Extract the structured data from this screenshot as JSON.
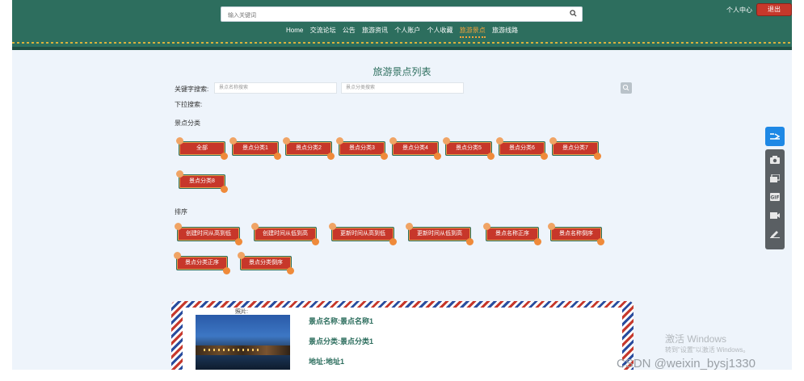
{
  "header": {
    "search_placeholder": "输入关键词",
    "nav": [
      "Home",
      "交流论坛",
      "公告",
      "旅游资讯",
      "个人账户",
      "个人收藏",
      "旅游景点",
      "旅游线路"
    ],
    "active_nav": "旅游景点",
    "user_center": "个人中心",
    "logout": "退出"
  },
  "page": {
    "title": "旅游景点列表",
    "keyword_label": "关键字搜索:",
    "name_placeholder": "景点名称搜索",
    "category_placeholder": "景点分类搜索",
    "dropdown_label": "下拉搜索:",
    "category_section": "景点分类",
    "categories": [
      "全部",
      "景点分类1",
      "景点分类2",
      "景点分类3",
      "景点分类4",
      "景点分类5",
      "景点分类6",
      "景点分类7",
      "景点分类8"
    ],
    "sort_section": "排序",
    "sorts": [
      "创建时间从高到低",
      "创建时间从低到高",
      "更新时间从高到低",
      "更新时间从低到高",
      "景点名称正序",
      "景点名称倒序",
      "景点分类正序",
      "景点分类倒序"
    ]
  },
  "card": {
    "photo_label": "照片:",
    "name": "景点名称:景点名称1",
    "category": "景点分类:景点分类1",
    "address": "地址:地址1"
  },
  "overlay": {
    "windows_title": "激活 Windows",
    "windows_sub": "转到\"设置\"以激活 Windows。",
    "csdn": "CSDN @weixin_bysj1330"
  },
  "colors": {
    "header": "#2d6e5e",
    "accent": "#c6382b",
    "active_nav": "#f2a23a"
  }
}
